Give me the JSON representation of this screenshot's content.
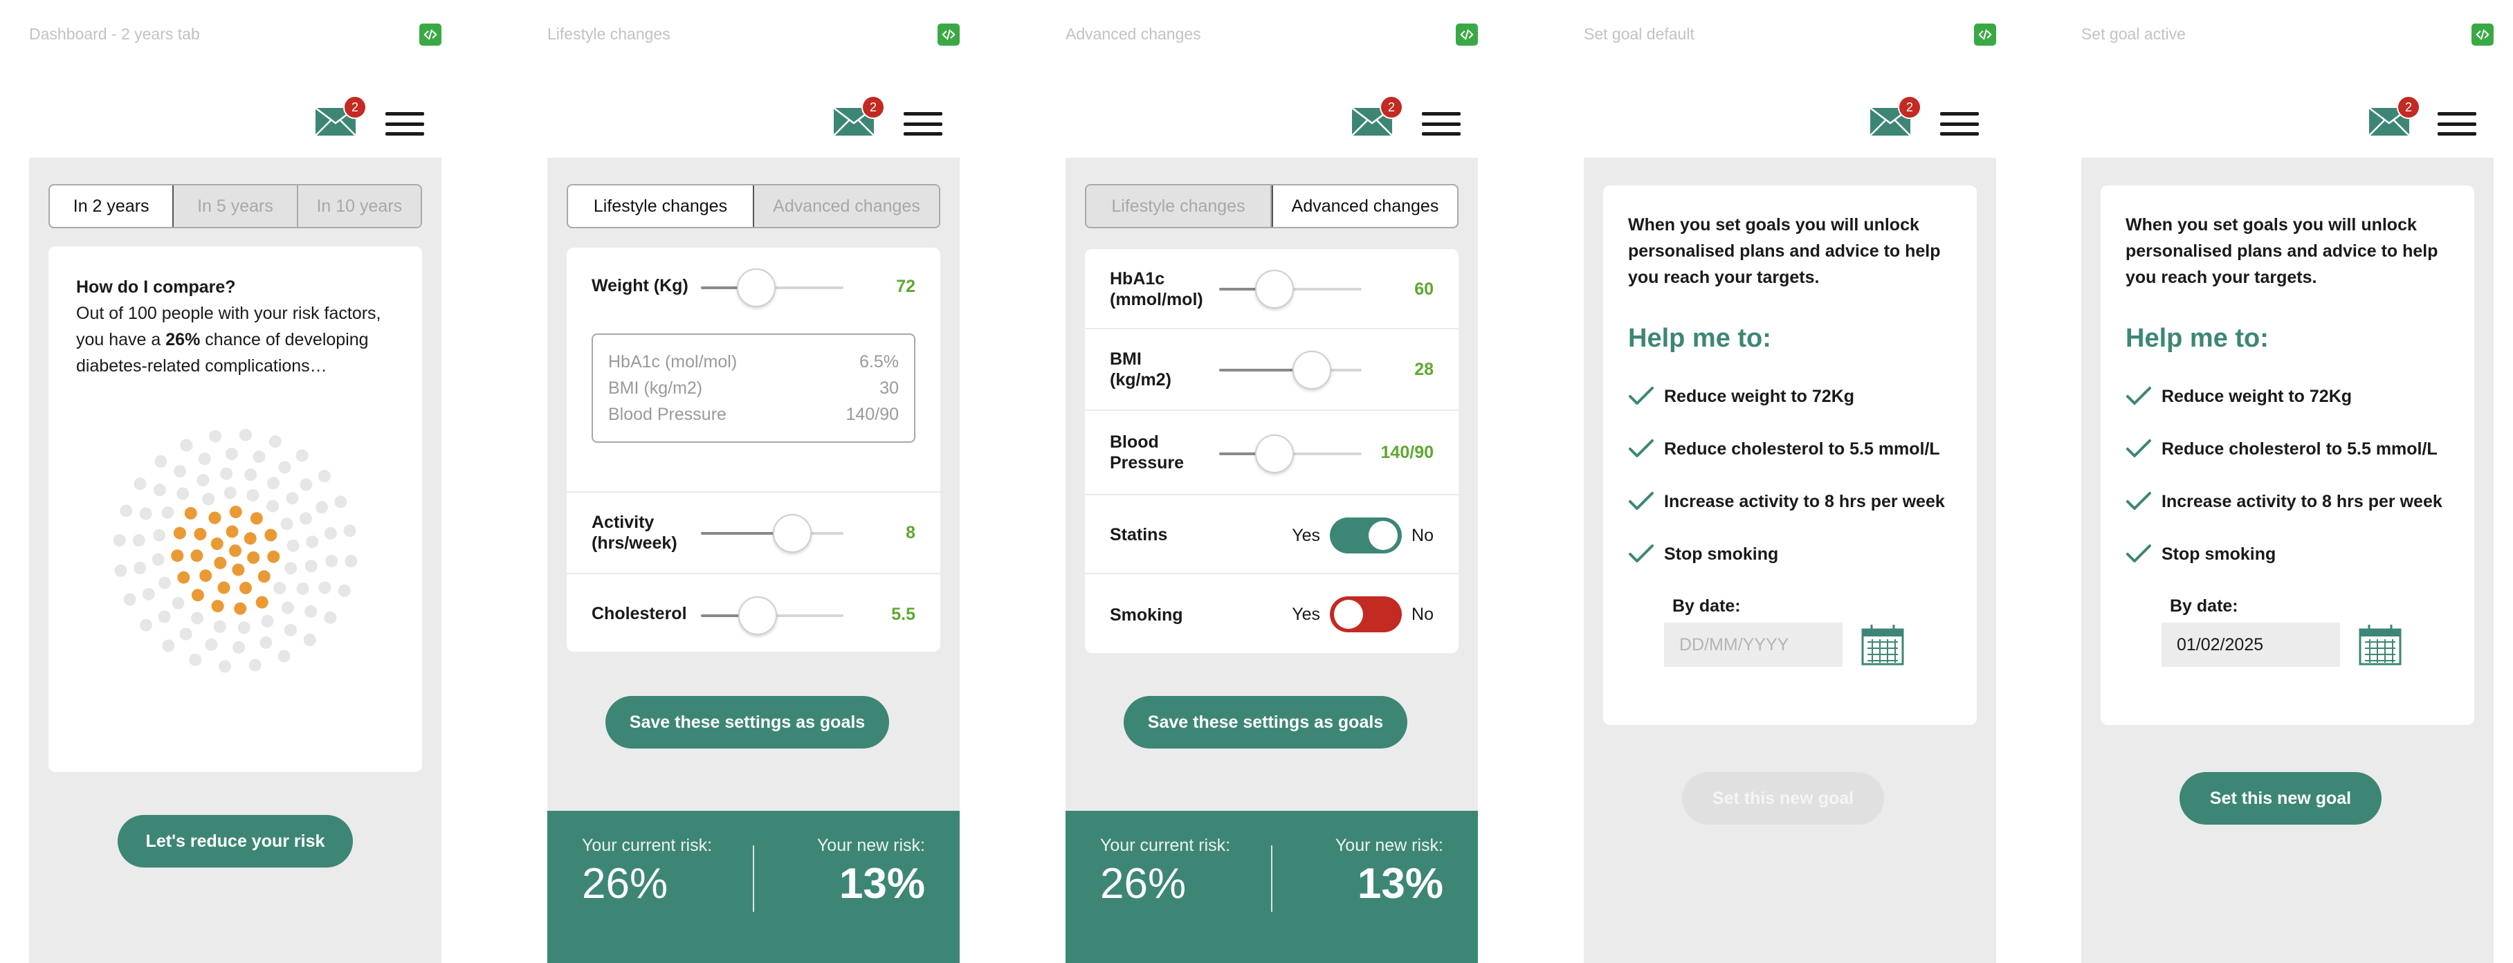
{
  "header": {
    "mail_count": "2"
  },
  "screens": [
    {
      "label": "Dashboard - 2 years tab",
      "tabs": [
        "In 2 years",
        "In 5 years",
        "In 10 years"
      ],
      "compare": {
        "title": "How do I compare?",
        "line1": "Out of 100 people with your risk factors,",
        "line2_pre": "you have a ",
        "line2_bold": "26%",
        "line2_post": " chance of developing",
        "line3": "diabetes-related complications…"
      },
      "button": "Let's reduce your risk",
      "risk_dots": {
        "total": 100,
        "highlighted": 26,
        "highlight_color": "#ea9a34",
        "base_color": "#e6e6e6"
      }
    },
    {
      "label": "Lifestyle changes",
      "tabs": [
        "Lifestyle changes",
        "Advanced changes"
      ],
      "weight": {
        "label": "Weight (Kg)",
        "value": "72"
      },
      "derived": [
        {
          "label": "HbA1c (mol/mol)",
          "value": "6.5%"
        },
        {
          "label": "BMI (kg/m2)",
          "value": "30"
        },
        {
          "label": "Blood Pressure",
          "value": "140/90"
        }
      ],
      "activity": {
        "label1": "Activity",
        "label2": "(hrs/week)",
        "value": "8"
      },
      "cholesterol": {
        "label": "Cholesterol",
        "value": "5.5"
      },
      "button": "Save these settings as goals",
      "risk": {
        "current_label": "Your current risk:",
        "current": "26%",
        "new_label": "Your new risk:",
        "new": "13%"
      }
    },
    {
      "label": "Advanced changes",
      "tabs": [
        "Lifestyle changes",
        "Advanced changes"
      ],
      "hba1c": {
        "label1": "HbA1c",
        "label2": "(mmol/mol)",
        "value": "60"
      },
      "bmi": {
        "label1": "BMI",
        "label2": "(kg/m2)",
        "value": "28"
      },
      "bp": {
        "label1": "Blood",
        "label2": "Pressure",
        "value": "140/90"
      },
      "statins": {
        "label": "Statins",
        "yes": "Yes",
        "no": "No",
        "on": true
      },
      "smoking": {
        "label": "Smoking",
        "yes": "Yes",
        "no": "No",
        "on": false
      },
      "button": "Save these settings as goals",
      "risk": {
        "current_label": "Your current risk:",
        "current": "26%",
        "new_label": "Your new risk:",
        "new": "13%"
      }
    },
    {
      "label": "Set goal default",
      "intro1": "When you set goals you will unlock",
      "intro2": "personalised plans and advice to help",
      "intro3": "you reach your targets.",
      "heading": "Help me to:",
      "goals": [
        "Reduce weight to 72Kg",
        "Reduce cholesterol to 5.5 mmol/L",
        "Increase activity to 8 hrs per week",
        "Stop smoking"
      ],
      "by_date": "By date:",
      "date_placeholder": "DD/MM/YYYY",
      "button": "Set this new goal"
    },
    {
      "label": "Set goal active",
      "intro1": "When you set goals you will unlock",
      "intro2": "personalised plans and advice to help",
      "intro3": "you reach your targets.",
      "heading": "Help me to:",
      "goals": [
        "Reduce weight to 72Kg",
        "Reduce cholesterol to 5.5 mmol/L",
        "Increase activity to 8 hrs per week",
        "Stop smoking"
      ],
      "by_date": "By date:",
      "date_value": "01/02/2025",
      "button": "Set this new goal"
    }
  ],
  "colors": {
    "teal": "#3d8676",
    "green_value": "#5fa830",
    "red_badge": "#c22a22",
    "orange_dot": "#ea9a34",
    "toggle_on": "#3d8676",
    "toggle_off_red": "#c22a22"
  },
  "icons": [
    "code-icon",
    "mail-icon",
    "menu-icon",
    "check-icon",
    "calendar-icon"
  ]
}
